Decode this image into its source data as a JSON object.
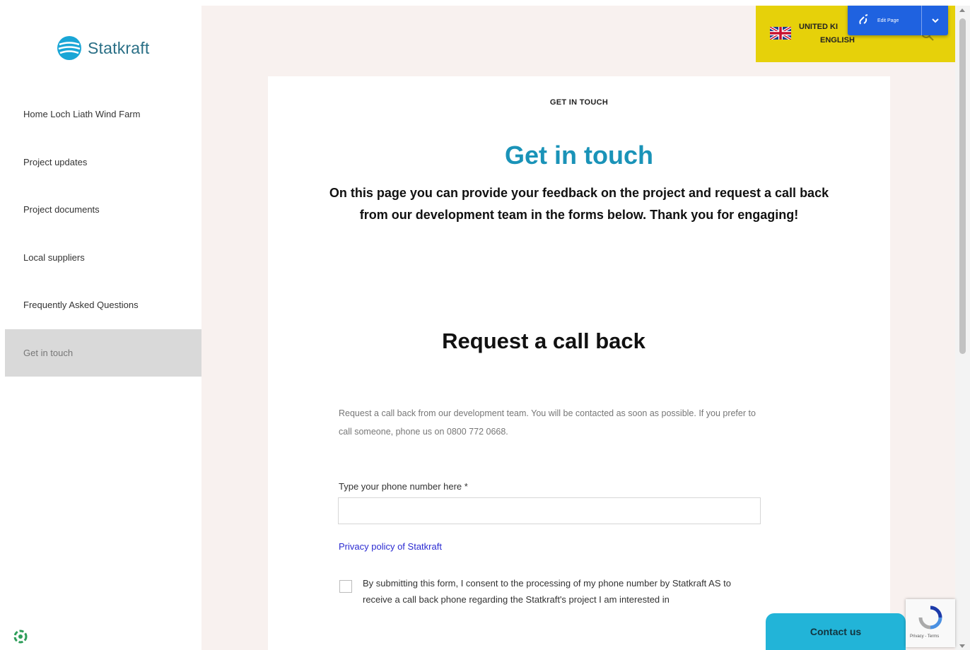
{
  "brand": {
    "name": "Statkraft"
  },
  "sidebar": {
    "items": [
      {
        "label": "Home Loch Liath Wind Farm",
        "active": false
      },
      {
        "label": "Project updates",
        "active": false
      },
      {
        "label": "Project documents",
        "active": false
      },
      {
        "label": "Local suppliers",
        "active": false
      },
      {
        "label": "Frequently Asked Questions",
        "active": false
      },
      {
        "label": "Get in touch",
        "active": true
      }
    ]
  },
  "locale": {
    "country": "UNITED KI",
    "language": "ENGLISH"
  },
  "editor": {
    "edit_label": "Edit Page"
  },
  "main": {
    "eyebrow": "GET IN TOUCH",
    "title": "Get in touch",
    "intro": "On this page you can provide your feedback on the project and request a call back from our development team in the forms below. Thank you for engaging!",
    "section_title": "Request a call back",
    "description": "Request a call back from our development team. You will be contacted as soon as possible. If you prefer to call someone, phone us on 0800 772 0668.",
    "phone_label": "Type your phone number here *",
    "phone_value": "",
    "privacy_link": "Privacy policy of Statkraft",
    "consent_text": "By submitting this form, I consent to the processing of my phone number by Statkraft AS to receive a call back phone regarding the Statkraft's project I am interested in"
  },
  "contact_button": {
    "label": "Contact us"
  },
  "recaptcha": {
    "text": "Privacy - Terms"
  },
  "colors": {
    "accent": "#1a93b8",
    "locale_bg": "#e6d10a",
    "editor_bar": "#1f62e0",
    "contact_button": "#22b4d8",
    "main_bg": "#f8f1ef"
  }
}
